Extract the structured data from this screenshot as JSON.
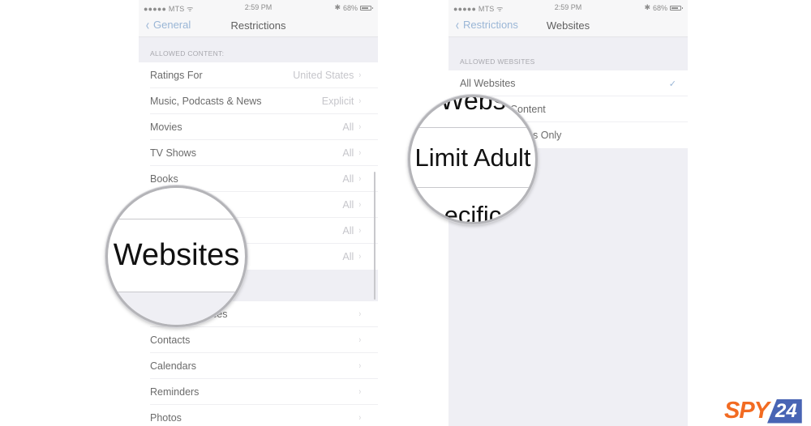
{
  "status_bar": {
    "carrier": "●●●●● MTS ᯤ",
    "time": "2:59 PM",
    "bluetooth": "✱",
    "battery_percent": "68%",
    "battery_level": 0.68
  },
  "left_screen": {
    "nav": {
      "back_label": "General",
      "title": "Restrictions"
    },
    "section_header": "ALLOWED CONTENT:",
    "rows": [
      {
        "label": "Ratings For",
        "value": "United States"
      },
      {
        "label": "Music, Podcasts & News",
        "value": "Explicit"
      },
      {
        "label": "Movies",
        "value": "All"
      },
      {
        "label": "TV Shows",
        "value": "All"
      },
      {
        "label": "Books",
        "value": "All"
      },
      {
        "label": "",
        "value": "All"
      },
      {
        "label": "",
        "value": "All"
      },
      {
        "label": "",
        "value": "All"
      }
    ],
    "privacy_rows": [
      {
        "label": "Location Services",
        "visible_fragment": "ces"
      },
      {
        "label": "Contacts"
      },
      {
        "label": "Calendars"
      },
      {
        "label": "Reminders"
      },
      {
        "label": "Photos"
      }
    ],
    "magnifier_text": "Websites"
  },
  "right_screen": {
    "nav": {
      "back_label": "Restrictions",
      "title": "Websites"
    },
    "section_header": "ALLOWED WEBSITES",
    "rows": [
      {
        "label": "All Websites",
        "checked": true,
        "check_glyph": "✓"
      },
      {
        "label": "Limit Adult Content",
        "visible_fragment": "Content",
        "checked": false
      },
      {
        "label": "Specific Websites Only",
        "visible_fragment": "s Only",
        "checked": false
      }
    ],
    "magnifier_text": "Limit Adult",
    "magnifier_top_fragment": "Webs",
    "magnifier_bottom_fragment": "ecific"
  },
  "glyphs": {
    "chevron_right": "›",
    "chevron_left": "‹"
  },
  "branding": {
    "logo_left": "SPY",
    "logo_right": "24",
    "colors": {
      "orange": "#f26b22",
      "blue": "#4864b4"
    }
  },
  "colors": {
    "ios_blue_faded": "#9ab6d6",
    "group_bg": "#efeff4"
  }
}
